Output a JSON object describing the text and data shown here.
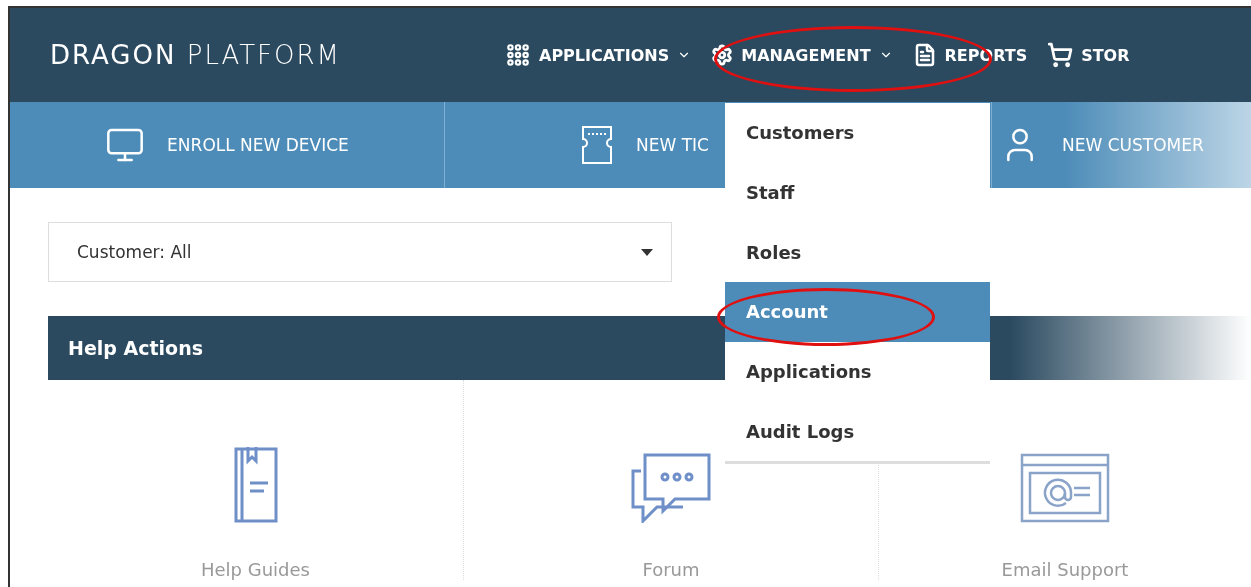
{
  "brand": "**DRAGON** PLATFORM",
  "nav": [
    {
      "kind": "grid",
      "label": "APPLICATIONS",
      "dropdown": true
    },
    {
      "kind": "gears",
      "label": "MANAGEMENT",
      "dropdown": true
    },
    {
      "kind": "report",
      "label": "REPORTS",
      "dropdown": false
    },
    {
      "kind": "cart",
      "label": "STOR",
      "dropdown": false
    }
  ],
  "actions": [
    {
      "kind": "monitor",
      "label": "ENROLL NEW DEVICE"
    },
    {
      "kind": "ticket",
      "label": "NEW TIC"
    },
    {
      "kind": "user",
      "label": "NEW CUSTOMER"
    }
  ],
  "customer_select": {
    "value": "Customer: All"
  },
  "help_actions": {
    "title": "Help Actions",
    "cards": [
      {
        "kind": "book",
        "label": "Help Guides"
      },
      {
        "kind": "chat",
        "label": "Forum"
      },
      {
        "kind": "email",
        "label": "Email Support"
      }
    ]
  },
  "menu": [
    {
      "label": "Customers",
      "selected": false
    },
    {
      "label": "Staff",
      "selected": false
    },
    {
      "label": "Roles",
      "selected": false
    },
    {
      "label": "Account",
      "selected": true
    },
    {
      "label": "Applications",
      "selected": false
    },
    {
      "label": "Audit Logs",
      "selected": false
    }
  ]
}
